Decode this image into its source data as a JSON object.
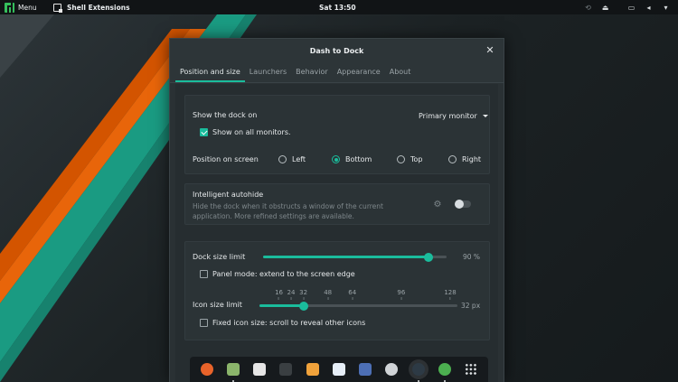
{
  "topbar": {
    "menu_label": "Menu",
    "active_app": "Shell Extensions",
    "clock": "Sat 13:50",
    "tray_icons": [
      "sync-icon",
      "eject-icon",
      "display-icon",
      "volume-icon",
      "power-icon"
    ]
  },
  "dialog": {
    "title": "Dash to Dock",
    "close_glyph": "✕",
    "tabs": [
      {
        "label": "Position and size",
        "active": true
      },
      {
        "label": "Launchers",
        "active": false
      },
      {
        "label": "Behavior",
        "active": false
      },
      {
        "label": "Appearance",
        "active": false
      },
      {
        "label": "About",
        "active": false
      }
    ],
    "show_dock_on": {
      "label": "Show the dock on",
      "selected": "Primary monitor",
      "all_monitors_label": "Show on all monitors.",
      "all_monitors_checked": true
    },
    "position": {
      "label": "Position on screen",
      "options": [
        "Left",
        "Bottom",
        "Top",
        "Right"
      ],
      "selected": "Bottom"
    },
    "autohide": {
      "label": "Intelligent autohide",
      "description_1": "Hide the dock when it obstructs a window of the current",
      "description_2": "application. More refined settings are available.",
      "enabled": false
    },
    "dock_size": {
      "label": "Dock size limit",
      "value_text": "90 %",
      "value": 0.9,
      "panel_mode_label": "Panel mode: extend to the screen edge",
      "panel_mode_checked": false
    },
    "icon_size": {
      "label": "Icon size limit",
      "ticks": [
        "16",
        "24",
        "32",
        "48",
        "64",
        "96",
        "128"
      ],
      "value": 32,
      "value_text": "32 px",
      "fixed_label": "Fixed icon size: scroll to reveal other icons",
      "fixed_checked": false
    }
  },
  "dock": {
    "items": [
      {
        "name": "firefox-icon",
        "color": "#e8632a",
        "running": false
      },
      {
        "name": "files-icon",
        "color": "#8bb56b",
        "running": true
      },
      {
        "name": "text-editor-icon",
        "color": "#e6e6e6",
        "running": false
      },
      {
        "name": "terminal-icon",
        "color": "#3a3f42",
        "running": false
      },
      {
        "name": "downloader-icon",
        "color": "#f0a23b",
        "running": false
      },
      {
        "name": "chat-icon",
        "color": "#e6eef7",
        "running": false
      },
      {
        "name": "screenshot-icon",
        "color": "#4d6fb5",
        "running": false
      },
      {
        "name": "disks-icon",
        "color": "#d0d4d7",
        "running": false
      },
      {
        "name": "settings-icon",
        "color": "#2d3a45",
        "running": true
      },
      {
        "name": "software-icon",
        "color": "#4caf50",
        "running": true
      },
      {
        "name": "app-grid-icon",
        "color": "#dfe3e5",
        "running": false
      }
    ]
  }
}
